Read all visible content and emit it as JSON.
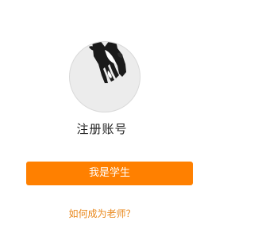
{
  "register": {
    "avatar_icon": "hand-drawing-avatar-icon",
    "title": "注册账号",
    "primary_button_label": "我是学生",
    "secondary_link_label": "如何成为老师？"
  },
  "colors": {
    "accent": "#ff8000",
    "link": "#e9881c",
    "text": "#222222",
    "avatar_bg": "#ececec",
    "avatar_border": "#d9d9d9"
  }
}
